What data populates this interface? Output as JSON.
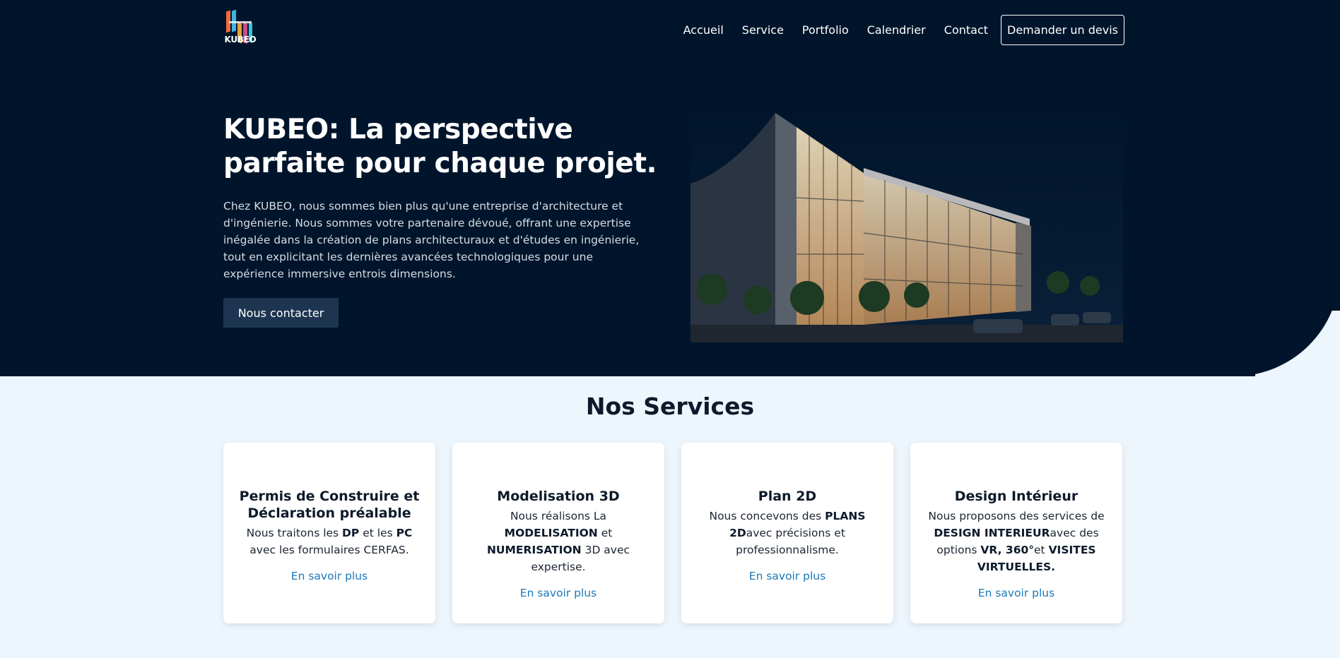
{
  "brand": {
    "name": "KUBEO"
  },
  "nav": {
    "items": [
      "Accueil",
      "Service",
      "Portfolio",
      "Calendrier",
      "Contact"
    ],
    "cta": "Demander un devis"
  },
  "hero": {
    "title": "KUBEO: La perspective parfaite pour chaque projet.",
    "text": "Chez KUBEO, nous sommes bien plus qu'une entreprise d'architecture et d'ingénierie. Nous sommes votre partenaire dévoué, offrant une expertise inégalée dans la création de plans architecturaux et d'études en ingénierie, tout en explicitant les dernières avancées technologiques pour une expérience immersive entrois dimensions.",
    "button": "Nous contacter"
  },
  "services": {
    "title": "Nos Services",
    "cards": [
      {
        "title": "Permis de Construire et Déclaration préalable",
        "text": [
          {
            "t": "Nous traitons les ",
            "b": false
          },
          {
            "t": "DP",
            "b": true
          },
          {
            "t": " et les ",
            "b": false
          },
          {
            "t": "PC",
            "b": true
          },
          {
            "t": " avec les formulaires CERFAS.",
            "b": false
          }
        ],
        "link": "En savoir plus"
      },
      {
        "title": "Modelisation 3D",
        "text": [
          {
            "t": "Nous réalisons La ",
            "b": false
          },
          {
            "t": "MODELISATION",
            "b": true
          },
          {
            "t": " et ",
            "b": false
          },
          {
            "t": "NUMERISATION",
            "b": true
          },
          {
            "t": " 3D avec expertise.",
            "b": false
          }
        ],
        "link": "En savoir plus"
      },
      {
        "title": "Plan 2D",
        "text": [
          {
            "t": "Nous concevons des ",
            "b": false
          },
          {
            "t": "PLANS 2D",
            "b": true
          },
          {
            "t": "avec précisions et professionnalisme.",
            "b": false
          }
        ],
        "link": "En savoir plus"
      },
      {
        "title": "Design Intérieur",
        "text": [
          {
            "t": "Nous proposons des services de ",
            "b": false
          },
          {
            "t": "DESIGN INTERIEUR",
            "b": true
          },
          {
            "t": "avec des options ",
            "b": false
          },
          {
            "t": "VR, 360°",
            "b": true
          },
          {
            "t": "et ",
            "b": false
          },
          {
            "t": "VISITES VIRTUELLES.",
            "b": true
          }
        ],
        "link": "En savoir plus"
      }
    ]
  },
  "colors": {
    "hero_bg": "#00152b",
    "page_bg": "#eef6fd",
    "button_bg": "#1d3550",
    "link": "#1b78b8"
  }
}
